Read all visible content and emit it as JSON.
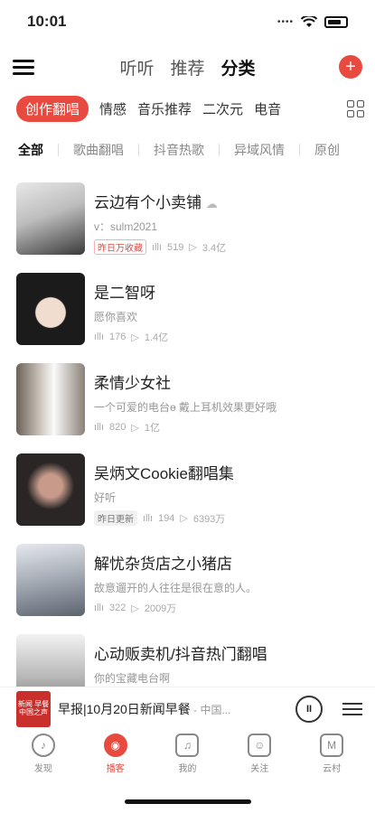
{
  "status": {
    "time": "10:01"
  },
  "topnav": {
    "tabs": [
      "听听",
      "推荐",
      "分类"
    ],
    "active_tab": 2
  },
  "categories": {
    "items": [
      "创作翻唱",
      "情感",
      "音乐推荐",
      "二次元",
      "电音"
    ],
    "active": 0
  },
  "subcategories": {
    "items": [
      "全部",
      "歌曲翻唱",
      "抖音热歌",
      "异域风情",
      "原创"
    ],
    "active": 0
  },
  "list": [
    {
      "title": "云边有个小卖铺",
      "subtitle": "v：sulm2021",
      "tag": "昨日万收藏",
      "plays": "519",
      "count": "3.4亿"
    },
    {
      "title": "是二智呀",
      "subtitle": "愿你喜欢",
      "plays": "176",
      "count": "1.4亿"
    },
    {
      "title": "柔情少女社",
      "subtitle": "一个可爱的电台ө 戴上耳机效果更好哦",
      "plays": "820",
      "count": "1亿"
    },
    {
      "title": "吴炳文Cookie翻唱集",
      "subtitle": "好听",
      "tag": "昨日更新",
      "plays": "194",
      "count": "6393万"
    },
    {
      "title": "解忧杂货店之小猪店",
      "subtitle": "故意遛开的人往往是很在意的人。",
      "plays": "322",
      "count": "2009万"
    },
    {
      "title": "心动贩卖机/抖音热门翻唱",
      "subtitle": "你的宝藏电台啊"
    }
  ],
  "player": {
    "title": "早报|10月20日新闻早餐",
    "artist": " - 中国...",
    "cover_text": "新闻 早餐 中国之声",
    "pause_label": "II"
  },
  "bottom_nav": {
    "items": [
      "发现",
      "播客",
      "我的",
      "关注",
      "云村"
    ],
    "active": 1
  },
  "colors": {
    "accent": "#e84a3f"
  }
}
